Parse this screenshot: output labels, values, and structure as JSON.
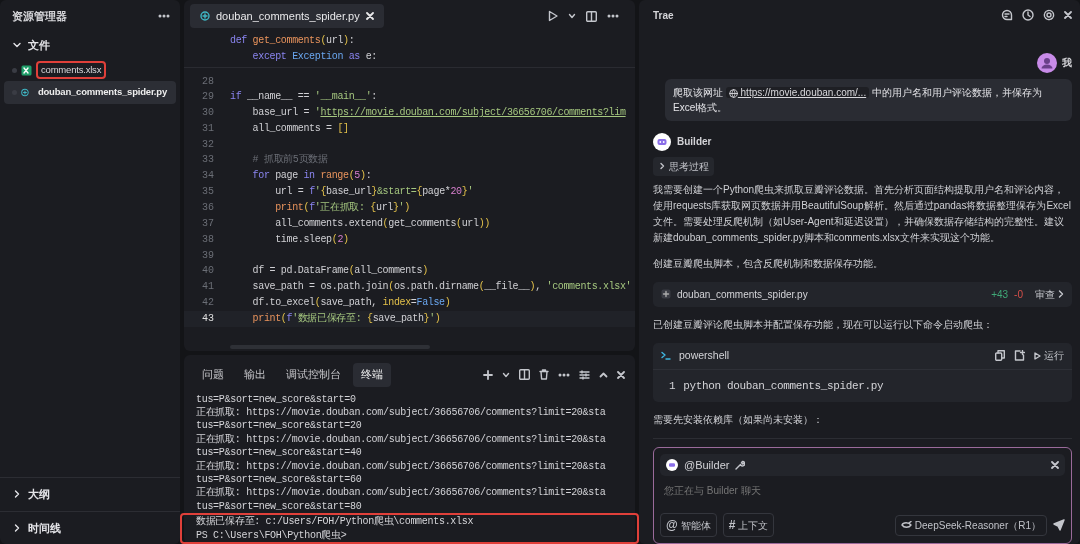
{
  "explorer": {
    "title": "资源管理器",
    "section": {
      "label": "文件",
      "expanded": true
    },
    "files": [
      {
        "name": "comments.xlsx",
        "kind": "excel",
        "selected": false,
        "highlighted": true
      },
      {
        "name": "douban_comments_spider.py",
        "kind": "python",
        "selected": true,
        "highlighted": false
      }
    ],
    "bottom_sections": [
      {
        "label": "大纲",
        "expanded": false
      },
      {
        "label": "时间线",
        "expanded": false
      }
    ]
  },
  "editor": {
    "tab": {
      "label": "douban_comments_spider.py",
      "selected": true
    },
    "sticky_lines": [
      [
        {
          "kind": "kw",
          "text": "def "
        },
        {
          "kind": "fn",
          "text": "get_comments"
        },
        {
          "kind": "brk",
          "text": "("
        },
        {
          "kind": "plain",
          "text": "url"
        },
        {
          "kind": "brk",
          "text": ")"
        },
        {
          "kind": "plain",
          "text": ":"
        }
      ],
      [
        {
          "kind": "kw",
          "text": "    except "
        },
        {
          "kind": "cls",
          "text": "Exception "
        },
        {
          "kind": "kw",
          "text": "as"
        },
        {
          "kind": "plain",
          "text": " e:"
        }
      ]
    ],
    "lines": [
      {
        "number": "28",
        "current": false
      },
      {
        "number": "29",
        "current": false,
        "tokens": [
          {
            "kind": "kw",
            "text": "if"
          },
          {
            "kind": "plain",
            "text": " __name__ == "
          },
          {
            "kind": "str",
            "text": "'__main__'"
          },
          {
            "kind": "plain",
            "text": ":"
          }
        ]
      },
      {
        "number": "30",
        "current": false,
        "tokens": [
          {
            "kind": "plain",
            "text": "    base_url = "
          },
          {
            "kind": "str",
            "text": "'"
          },
          {
            "kind": "url",
            "text": "https://movie.douban.com/subject/36656706/comments?lim"
          }
        ]
      },
      {
        "number": "31",
        "current": false,
        "tokens": [
          {
            "kind": "plain",
            "text": "    all_comments = "
          },
          {
            "kind": "brk",
            "text": "[]"
          }
        ]
      },
      {
        "number": "32",
        "current": false
      },
      {
        "number": "33",
        "current": false,
        "tokens": [
          {
            "kind": "cmt",
            "text": "    # 抓取前5页数据"
          }
        ]
      },
      {
        "number": "34",
        "current": false,
        "tokens": [
          {
            "kind": "kw",
            "text": "    for"
          },
          {
            "kind": "plain",
            "text": " page "
          },
          {
            "kind": "kw",
            "text": "in "
          },
          {
            "kind": "fn",
            "text": "range"
          },
          {
            "kind": "brk",
            "text": "("
          },
          {
            "kind": "num",
            "text": "5"
          },
          {
            "kind": "brk",
            "text": ")"
          },
          {
            "kind": "plain",
            "text": ":"
          }
        ]
      },
      {
        "number": "35",
        "current": false,
        "tokens": [
          {
            "kind": "plain",
            "text": "        url = "
          },
          {
            "kind": "kw",
            "text": "f"
          },
          {
            "kind": "str",
            "text": "'"
          },
          {
            "kind": "brk",
            "text": "{"
          },
          {
            "kind": "plain",
            "text": "base_url"
          },
          {
            "kind": "brk",
            "text": "}"
          },
          {
            "kind": "str",
            "text": "&start="
          },
          {
            "kind": "brk",
            "text": "{"
          },
          {
            "kind": "plain",
            "text": "page*"
          },
          {
            "kind": "num",
            "text": "20"
          },
          {
            "kind": "brk",
            "text": "}"
          },
          {
            "kind": "str",
            "text": "'"
          }
        ]
      },
      {
        "number": "36",
        "current": false,
        "tokens": [
          {
            "kind": "fn",
            "text": "        print"
          },
          {
            "kind": "brk",
            "text": "("
          },
          {
            "kind": "kw",
            "text": "f"
          },
          {
            "kind": "str",
            "text": "'正在抓取: "
          },
          {
            "kind": "brk",
            "text": "{"
          },
          {
            "kind": "plain",
            "text": "url"
          },
          {
            "kind": "brk",
            "text": "}"
          },
          {
            "kind": "str",
            "text": "'"
          },
          {
            "kind": "brk",
            "text": ")"
          }
        ]
      },
      {
        "number": "37",
        "current": false,
        "tokens": [
          {
            "kind": "plain",
            "text": "        all_comments.extend"
          },
          {
            "kind": "brk",
            "text": "("
          },
          {
            "kind": "plain",
            "text": "get_comments"
          },
          {
            "kind": "brk",
            "text": "("
          },
          {
            "kind": "plain",
            "text": "url"
          },
          {
            "kind": "brk",
            "text": "))"
          }
        ]
      },
      {
        "number": "38",
        "current": false,
        "tokens": [
          {
            "kind": "plain",
            "text": "        time.sleep"
          },
          {
            "kind": "brk",
            "text": "("
          },
          {
            "kind": "num",
            "text": "2"
          },
          {
            "kind": "brk",
            "text": ")"
          }
        ]
      },
      {
        "number": "39",
        "current": false
      },
      {
        "number": "40",
        "current": false,
        "tokens": [
          {
            "kind": "plain",
            "text": "    df = pd.DataFrame"
          },
          {
            "kind": "brk",
            "text": "("
          },
          {
            "kind": "plain",
            "text": "all_comments"
          },
          {
            "kind": "brk",
            "text": ")"
          }
        ]
      },
      {
        "number": "41",
        "current": false,
        "tokens": [
          {
            "kind": "plain",
            "text": "    save_path = os.path.join"
          },
          {
            "kind": "brk",
            "text": "("
          },
          {
            "kind": "plain",
            "text": "os.path.dirname"
          },
          {
            "kind": "brk",
            "text": "("
          },
          {
            "kind": "plain",
            "text": "__file__"
          },
          {
            "kind": "brk",
            "text": ")"
          },
          {
            "kind": "plain",
            "text": ", "
          },
          {
            "kind": "str",
            "text": "'comments.xlsx'"
          }
        ]
      },
      {
        "number": "42",
        "current": false,
        "tokens": [
          {
            "kind": "plain",
            "text": "    df.to_excel"
          },
          {
            "kind": "brk",
            "text": "("
          },
          {
            "kind": "plain",
            "text": "save_path, "
          },
          {
            "kind": "var",
            "text": "index"
          },
          {
            "kind": "plain",
            "text": "="
          },
          {
            "kind": "cls",
            "text": "False"
          },
          {
            "kind": "brk",
            "text": ")"
          }
        ]
      },
      {
        "number": "43",
        "current": true,
        "tokens": [
          {
            "kind": "fn",
            "text": "    print"
          },
          {
            "kind": "brk",
            "text": "("
          },
          {
            "kind": "kw",
            "text": "f"
          },
          {
            "kind": "str",
            "text": "'数据已保存至: "
          },
          {
            "kind": "brk",
            "text": "{"
          },
          {
            "kind": "plain",
            "text": "save_path"
          },
          {
            "kind": "brk",
            "text": "}"
          },
          {
            "kind": "str",
            "text": "'"
          },
          {
            "kind": "brk",
            "text": ")"
          }
        ]
      }
    ]
  },
  "terminal": {
    "tabs": [
      {
        "label": "问题",
        "selected": false
      },
      {
        "label": "输出",
        "selected": false
      },
      {
        "label": "调试控制台",
        "selected": false
      },
      {
        "label": "终端",
        "selected": true
      }
    ],
    "lines": [
      {
        "text": "tus=P&sort=new_score&start=0",
        "highlighted": false
      },
      {
        "text": "正在抓取: https://movie.douban.com/subject/36656706/comments?limit=20&sta",
        "highlighted": false
      },
      {
        "text": "tus=P&sort=new_score&start=20",
        "highlighted": false
      },
      {
        "text": "正在抓取: https://movie.douban.com/subject/36656706/comments?limit=20&sta",
        "highlighted": false
      },
      {
        "text": "tus=P&sort=new_score&start=40",
        "highlighted": false
      },
      {
        "text": "正在抓取: https://movie.douban.com/subject/36656706/comments?limit=20&sta",
        "highlighted": false
      },
      {
        "text": "tus=P&sort=new_score&start=60",
        "highlighted": false
      },
      {
        "text": "正在抓取: https://movie.douban.com/subject/36656706/comments?limit=20&sta",
        "highlighted": false
      },
      {
        "text": "tus=P&sort=new_score&start=80",
        "highlighted": false
      },
      {
        "text": "数据已保存至: c:/Users/FOH/Python爬虫\\comments.xlsx",
        "highlighted": true
      },
      {
        "text": "PS C:\\Users\\FOH\\Python爬虫>",
        "highlighted": true
      }
    ]
  },
  "chat": {
    "title": "Trae",
    "user": {
      "name": "我",
      "message_before": "爬取该网址",
      "link": "https://movie.douban.com/...",
      "message_after": "中的用户名和用户评论数据，并保存为Excel格式。"
    },
    "assistant": {
      "name": "Builder",
      "thinking": {
        "label": "思考过程",
        "expanded": false
      }
    },
    "blocks": [
      {
        "kind": "paragraph",
        "text": "我需要创建一个Python爬虫来抓取豆瓣评论数据。首先分析页面结构提取用户名和评论内容，使用requests库获取网页数据并用BeautifulSoup解析。然后通过pandas将数据整理保存为Excel文件。需要处理反爬机制（如User-Agent和延迟设置），并确保数据存储结构的完整性。建议新建douban_comments_spider.py脚本和comments.xlsx文件来实现这个功能。"
      },
      {
        "kind": "paragraph",
        "text": "创建豆瓣爬虫脚本，包含反爬机制和数据保存功能。"
      },
      {
        "kind": "file_change",
        "file": "douban_comments_spider.py",
        "added": "+43",
        "removed": "-0",
        "action": "审查"
      },
      {
        "kind": "paragraph",
        "text": "已创建豆瓣评论爬虫脚本并配置保存功能，现在可以运行以下命令启动爬虫："
      },
      {
        "kind": "code_block",
        "language": "powershell",
        "run_label": "运行",
        "lines": [
          {
            "number": "1",
            "text": "python douban_comments_spider.py"
          }
        ]
      },
      {
        "kind": "paragraph",
        "text": "需要先安装依赖库（如果尚未安装）："
      }
    ],
    "input": {
      "agent": "@Builder",
      "placeholder": "您正在与 Builder 聊天",
      "chips": [
        {
          "symbol": "@",
          "label": "智能体"
        },
        {
          "symbol": "#",
          "label": "上下文"
        }
      ],
      "model": "DeepSeek-Reasoner（R1）"
    }
  }
}
